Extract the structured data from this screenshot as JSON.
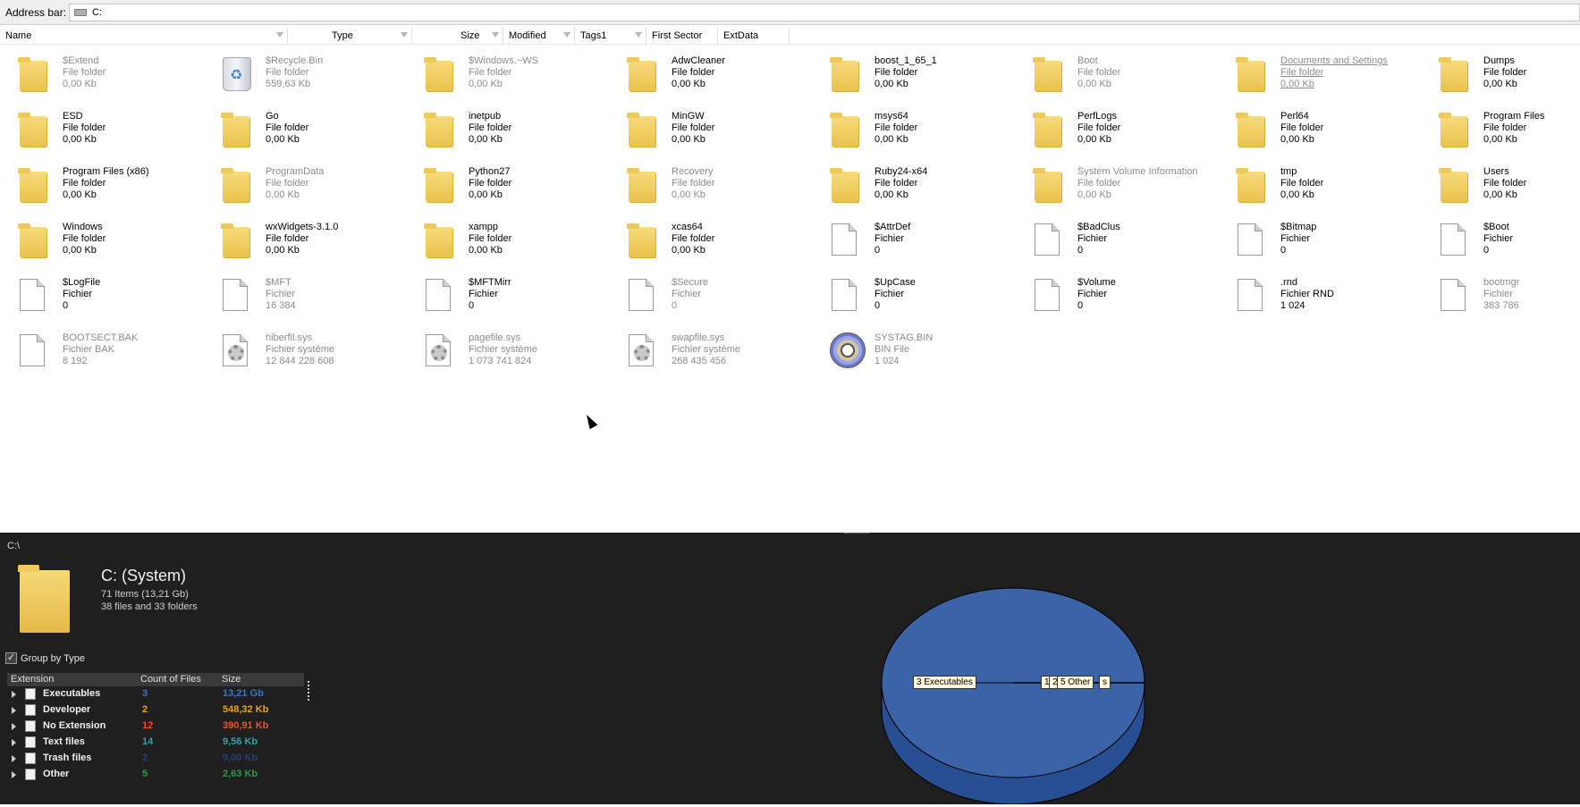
{
  "address_bar": {
    "label": "Address bar:",
    "value": "C:"
  },
  "columns": [
    "Name",
    "Type",
    "Size",
    "Modified",
    "Tags1",
    "First Sector",
    "ExtData"
  ],
  "items": [
    {
      "name": "$Extend",
      "type": "File folder",
      "size": "0,00 Kb",
      "icon": "folder-icon",
      "style": "dim"
    },
    {
      "name": "$Recycle.Bin",
      "type": "File folder",
      "size": "559,63 Kb",
      "icon": "recycle-bin-icon",
      "style": "dim"
    },
    {
      "name": "$Windows.~WS",
      "type": "File folder",
      "size": "0,00 Kb",
      "icon": "folder-icon",
      "style": "dim"
    },
    {
      "name": "AdwCleaner",
      "type": "File folder",
      "size": "0,00 Kb",
      "icon": "folder-icon",
      "style": "normal"
    },
    {
      "name": "boost_1_65_1",
      "type": "File folder",
      "size": "0,00 Kb",
      "icon": "folder-icon",
      "style": "normal"
    },
    {
      "name": "Boot",
      "type": "File folder",
      "size": "0,00 Kb",
      "icon": "folder-icon",
      "style": "dim"
    },
    {
      "name": "Documents and Settings",
      "type": "File folder",
      "size": "0,00 Kb",
      "icon": "folder-icon",
      "style": "link"
    },
    {
      "name": "Dumps",
      "type": "File folder",
      "size": "0,00 Kb",
      "icon": "folder-icon",
      "style": "normal"
    },
    {
      "name": "ESD",
      "type": "File folder",
      "size": "0,00 Kb",
      "icon": "folder-icon",
      "style": "normal"
    },
    {
      "name": "Go",
      "type": "File folder",
      "size": "0,00 Kb",
      "icon": "folder-icon",
      "style": "normal"
    },
    {
      "name": "inetpub",
      "type": "File folder",
      "size": "0,00 Kb",
      "icon": "folder-icon",
      "style": "normal"
    },
    {
      "name": "MinGW",
      "type": "File folder",
      "size": "0,00 Kb",
      "icon": "folder-icon",
      "style": "normal"
    },
    {
      "name": "msys64",
      "type": "File folder",
      "size": "0,00 Kb",
      "icon": "folder-icon",
      "style": "normal"
    },
    {
      "name": "PerfLogs",
      "type": "File folder",
      "size": "0,00 Kb",
      "icon": "folder-icon",
      "style": "normal"
    },
    {
      "name": "Perl64",
      "type": "File folder",
      "size": "0,00 Kb",
      "icon": "folder-icon",
      "style": "normal"
    },
    {
      "name": "Program Files",
      "type": "File folder",
      "size": "0,00 Kb",
      "icon": "folder-icon",
      "style": "normal"
    },
    {
      "name": "Program Files (x86)",
      "type": "File folder",
      "size": "0,00 Kb",
      "icon": "folder-icon",
      "style": "normal"
    },
    {
      "name": "ProgramData",
      "type": "File folder",
      "size": "0,00 Kb",
      "icon": "folder-icon",
      "style": "dim"
    },
    {
      "name": "Python27",
      "type": "File folder",
      "size": "0,00 Kb",
      "icon": "folder-icon",
      "style": "normal"
    },
    {
      "name": "Recovery",
      "type": "File folder",
      "size": "0,00 Kb",
      "icon": "folder-icon",
      "style": "dim"
    },
    {
      "name": "Ruby24-x64",
      "type": "File folder",
      "size": "0,00 Kb",
      "icon": "folder-icon",
      "style": "normal"
    },
    {
      "name": "System Volume Information",
      "type": "File folder",
      "size": "0,00 Kb",
      "icon": "folder-icon",
      "style": "dim"
    },
    {
      "name": "tmp",
      "type": "File folder",
      "size": "0,00 Kb",
      "icon": "folder-icon",
      "style": "normal"
    },
    {
      "name": "Users",
      "type": "File folder",
      "size": "0,00 Kb",
      "icon": "folder-icon",
      "style": "normal"
    },
    {
      "name": "Windows",
      "type": "File folder",
      "size": "0,00 Kb",
      "icon": "folder-icon",
      "style": "normal"
    },
    {
      "name": "wxWidgets-3.1.0",
      "type": "File folder",
      "size": "0,00 Kb",
      "icon": "folder-icon",
      "style": "normal"
    },
    {
      "name": "xampp",
      "type": "File folder",
      "size": "0,00 Kb",
      "icon": "folder-icon",
      "style": "normal"
    },
    {
      "name": "xcas64",
      "type": "File folder",
      "size": "0,00 Kb",
      "icon": "folder-icon",
      "style": "normal"
    },
    {
      "name": "$AttrDef",
      "type": "Fichier",
      "size": "0",
      "icon": "file-icon",
      "style": "normal"
    },
    {
      "name": "$BadClus",
      "type": "Fichier",
      "size": "0",
      "icon": "file-icon",
      "style": "normal"
    },
    {
      "name": "$Bitmap",
      "type": "Fichier",
      "size": "0",
      "icon": "file-icon",
      "style": "normal"
    },
    {
      "name": "$Boot",
      "type": "Fichier",
      "size": "0",
      "icon": "file-icon",
      "style": "normal"
    },
    {
      "name": "$LogFile",
      "type": "Fichier",
      "size": "0",
      "icon": "file-icon",
      "style": "normal"
    },
    {
      "name": "$MFT",
      "type": "Fichier",
      "size": "16 384",
      "icon": "file-icon",
      "style": "dim"
    },
    {
      "name": "$MFTMirr",
      "type": "Fichier",
      "size": "0",
      "icon": "file-icon",
      "style": "normal"
    },
    {
      "name": "$Secure",
      "type": "Fichier",
      "size": "0",
      "icon": "file-icon",
      "style": "dim"
    },
    {
      "name": "$UpCase",
      "type": "Fichier",
      "size": "0",
      "icon": "file-icon",
      "style": "normal"
    },
    {
      "name": "$Volume",
      "type": "Fichier",
      "size": "0",
      "icon": "file-icon",
      "style": "normal"
    },
    {
      "name": ".rnd",
      "type": "Fichier RND",
      "size": "1 024",
      "icon": "file-icon",
      "style": "normal"
    },
    {
      "name": "bootmgr",
      "type": "Fichier",
      "size": "383 786",
      "icon": "file-icon",
      "style": "dim"
    },
    {
      "name": "BOOTSECT.BAK",
      "type": "Fichier BAK",
      "size": "8 192",
      "icon": "file-icon",
      "style": "dim"
    },
    {
      "name": "hiberfil.sys",
      "type": "Fichier système",
      "size": "12 844 228 608",
      "icon": "system-file-icon",
      "style": "dim"
    },
    {
      "name": "pagefile.sys",
      "type": "Fichier système",
      "size": "1 073 741 824",
      "icon": "system-file-icon",
      "style": "dim"
    },
    {
      "name": "swapfile.sys",
      "type": "Fichier système",
      "size": "268 435 456",
      "icon": "system-file-icon",
      "style": "dim"
    },
    {
      "name": "SYSTAG.BIN",
      "type": "BIN File",
      "size": "1 024",
      "icon": "disc-icon",
      "style": "dim"
    }
  ],
  "panel": {
    "path": "C:\\",
    "title": "C: (System)",
    "info1": "71 Items (13,21 Gb)",
    "info2": "38 files and 33 folders",
    "group_by_label": "Group by Type",
    "group_by_checked": true,
    "table_headers": [
      "Extension",
      "Count of Files",
      "Size"
    ],
    "rows": [
      {
        "name": "Executables",
        "count": "3",
        "size": "13,21 Gb",
        "color": "#3d74c6"
      },
      {
        "name": "Developer",
        "count": "2",
        "size": "548,32 Kb",
        "color": "#f0a21e"
      },
      {
        "name": "No Extension",
        "count": "12",
        "size": "390,91 Kb",
        "color": "#e8552b"
      },
      {
        "name": "Text files",
        "count": "14",
        "size": "9,56 Kb",
        "color": "#2ea6a6"
      },
      {
        "name": "Trash files",
        "count": "2",
        "size": "9,00 Kb",
        "color": "#2a3f78"
      },
      {
        "name": "Other",
        "count": "5",
        "size": "2,63 Kb",
        "color": "#2f9a4a"
      }
    ]
  },
  "chart_data": {
    "type": "pie",
    "categories": [
      "Executables",
      "Developer",
      "No Extension",
      "Text files",
      "Trash files",
      "Other"
    ],
    "values": [
      13.21,
      0.000548,
      0.000391,
      9.6e-06,
      9e-06,
      2.6e-06
    ],
    "unit": "Gb",
    "labels": [
      {
        "text": "3 Executables"
      },
      {
        "text": "1"
      },
      {
        "text": "2"
      },
      {
        "text": "5 Other"
      },
      {
        "text": "s"
      }
    ],
    "top_color": "#3b63a8",
    "side_color": "#294f93"
  }
}
